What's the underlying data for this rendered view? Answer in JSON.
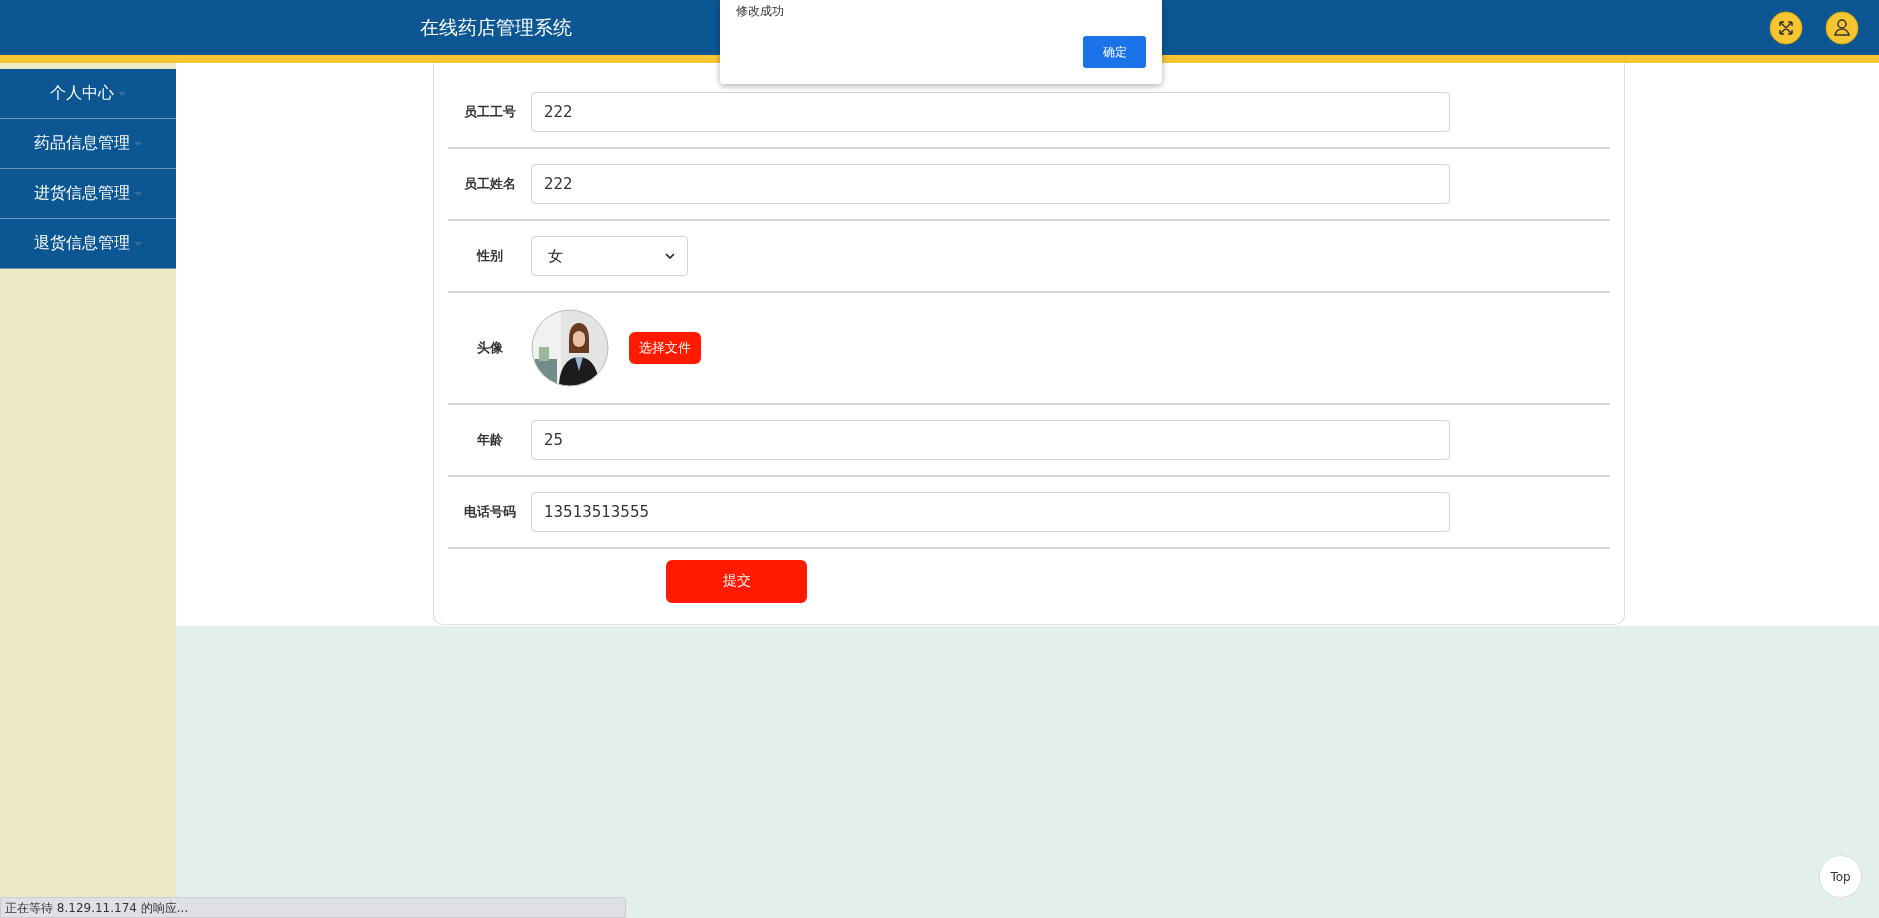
{
  "header": {
    "title": "在线药店管理系统"
  },
  "dialog": {
    "message": "修改成功",
    "button": "确定"
  },
  "sidebar": {
    "items": [
      {
        "label": "个人中心"
      },
      {
        "label": "药品信息管理"
      },
      {
        "label": "进货信息管理"
      },
      {
        "label": "退货信息管理"
      }
    ]
  },
  "form": {
    "fields": [
      {
        "kind": "text",
        "label": "员工工号",
        "value": "222"
      },
      {
        "kind": "text",
        "label": "员工姓名",
        "value": "222"
      },
      {
        "kind": "select",
        "label": "性别",
        "value": "女"
      },
      {
        "label": "头像",
        "button": "选择文件"
      },
      {
        "kind": "text",
        "label": "年龄",
        "value": "25"
      },
      {
        "kind": "text",
        "label": "电话号码",
        "value": "13513513555"
      }
    ],
    "submit": "提交"
  },
  "top_button": "Top",
  "status_bar": "正在等待 8.129.11.174 的响应..."
}
